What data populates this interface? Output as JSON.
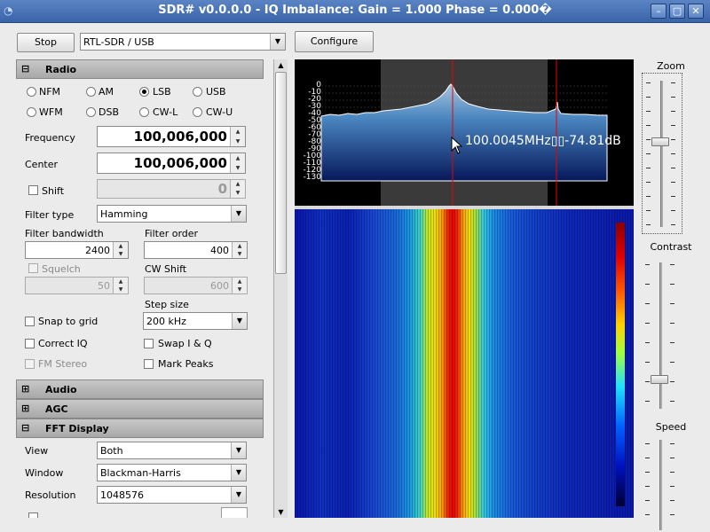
{
  "window": {
    "title": "SDR# v0.0.0.0 - IQ Imbalance: Gain = 1.000 Phase = 0.000�",
    "controls": [
      "minimize-icon",
      "maximize-icon",
      "close-icon"
    ]
  },
  "toolbar": {
    "stop_label": "Stop",
    "source_value": "RTL-SDR / USB",
    "configure_label": "Configure"
  },
  "radio": {
    "header": "Radio",
    "modes": [
      "NFM",
      "AM",
      "LSB",
      "USB",
      "WFM",
      "DSB",
      "CW-L",
      "CW-U"
    ],
    "selected_mode": "LSB",
    "frequency_label": "Frequency",
    "frequency_value": "100,006,000",
    "center_label": "Center",
    "center_value": "100,006,000",
    "shift_label": "Shift",
    "shift_value": "0",
    "filter_type_label": "Filter type",
    "filter_type_value": "Hamming",
    "filter_bandwidth_label": "Filter bandwidth",
    "filter_bandwidth_value": "2400",
    "filter_order_label": "Filter order",
    "filter_order_value": "400",
    "squelch_label": "Squelch",
    "squelch_value": "50",
    "cw_shift_label": "CW Shift",
    "cw_shift_value": "600",
    "step_size_label": "Step size",
    "step_size_value": "200 kHz",
    "snap_to_grid_label": "Snap to grid",
    "correct_iq_label": "Correct IQ",
    "swap_iq_label": "Swap I & Q",
    "fm_stereo_label": "FM Stereo",
    "mark_peaks_label": "Mark Peaks"
  },
  "audio": {
    "header": "Audio"
  },
  "agc": {
    "header": "AGC"
  },
  "fft": {
    "header": "FFT Display",
    "view_label": "View",
    "view_value": "Both",
    "window_label": "Window",
    "window_value": "Blackman-Harris",
    "resolution_label": "Resolution",
    "resolution_value": "1048576"
  },
  "spectrum": {
    "db_ticks": [
      "0",
      "-10",
      "-20",
      "-30",
      "-40",
      "-50",
      "-60",
      "-70",
      "-80",
      "-90",
      "-100",
      "-110",
      "-120",
      "-130"
    ],
    "readout": "100.0045MHz▯▯-74.81dB"
  },
  "sliders": {
    "zoom_label": "Zoom",
    "contrast_label": "Contrast",
    "speed_label": "Speed"
  }
}
